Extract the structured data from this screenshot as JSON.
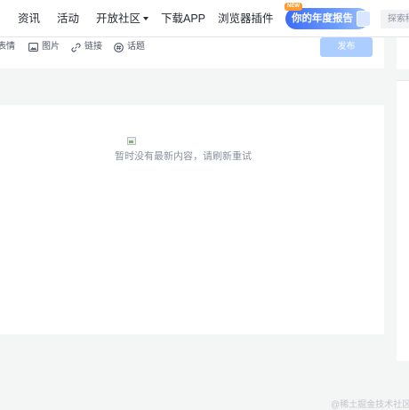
{
  "nav": {
    "items": [
      "资讯",
      "活动",
      "开放社区",
      "下载APP",
      "浏览器插件"
    ],
    "report_badge": "你的年度报告",
    "report_tag": "NEW",
    "search_placeholder": "探索稀土掘金"
  },
  "editor": {
    "tools": [
      "表情",
      "图片",
      "链接",
      "话题"
    ],
    "publish_label": "发布"
  },
  "feed": {
    "empty_message": "暂时没有最新内容，请刷新重试"
  },
  "watermark": "@稀土掘金技术社区",
  "colors": {
    "accent": "#1e80ff",
    "publish_disabled": "#abcdff",
    "page_bg": "#f4f5f5"
  }
}
